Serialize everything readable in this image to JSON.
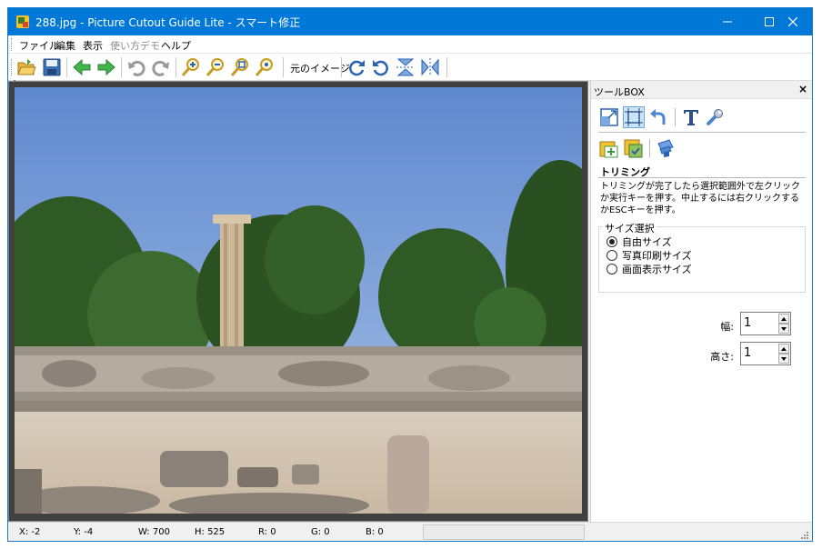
{
  "window": {
    "title": "288.jpg - Picture Cutout Guide Lite - スマート修正",
    "app_icon": "app-icon",
    "controls": [
      "minimize-icon",
      "maximize-icon",
      "close-icon"
    ]
  },
  "menu": {
    "items": [
      {
        "label": "ファイル",
        "enabled": true
      },
      {
        "label": "編集",
        "enabled": true
      },
      {
        "label": "表示",
        "enabled": true
      },
      {
        "label": "使い方デモ",
        "enabled": false
      },
      {
        "label": "ヘルプ",
        "enabled": true
      }
    ]
  },
  "toolbar": {
    "icons": [
      "open-folder-icon",
      "save-icon",
      "back-arrow-icon",
      "forward-arrow-icon",
      "undo-icon",
      "redo-icon",
      "zoom-in-icon",
      "zoom-out-icon",
      "zoom-fit-icon",
      "zoom-actual-icon",
      "rotate-right-icon",
      "rotate-left-icon",
      "flip-vertical-icon",
      "flip-horizontal-icon"
    ],
    "original_image_label": "元のイメージ"
  },
  "toolbox": {
    "title": "ツールBOX",
    "close_label": "×",
    "tools_row1": [
      "resize-icon",
      "crop-icon",
      "undo-tool-icon",
      "text-icon",
      "wrench-icon"
    ],
    "tools_row2": [
      "image-add-icon",
      "image-layer-icon",
      "stamp-icon"
    ],
    "selected_tool": "crop-icon",
    "section_title": "トリミング",
    "description": "トリミングが完了したら選択範囲外で左クリックか実行キーを押す。中止するには右クリックするかESCキーを押す。",
    "size_group": {
      "label": "サイズ選択",
      "options": [
        {
          "label": "自由サイズ",
          "checked": true
        },
        {
          "label": "写真印刷サイズ",
          "checked": false
        },
        {
          "label": "画面表示サイズ",
          "checked": false
        }
      ]
    },
    "width_label": "幅:",
    "width_value": "1",
    "height_label": "高さ:",
    "height_value": "1"
  },
  "status": {
    "x": "X: -2",
    "y": "Y: -4",
    "w": "W: 700",
    "h": "H: 525",
    "r": "R: 0",
    "g": "G: 0",
    "b": "B: 0"
  },
  "colors": {
    "titlebar": "#0078d7",
    "sky": "#6f97d6",
    "selection": "#cce4f7"
  }
}
